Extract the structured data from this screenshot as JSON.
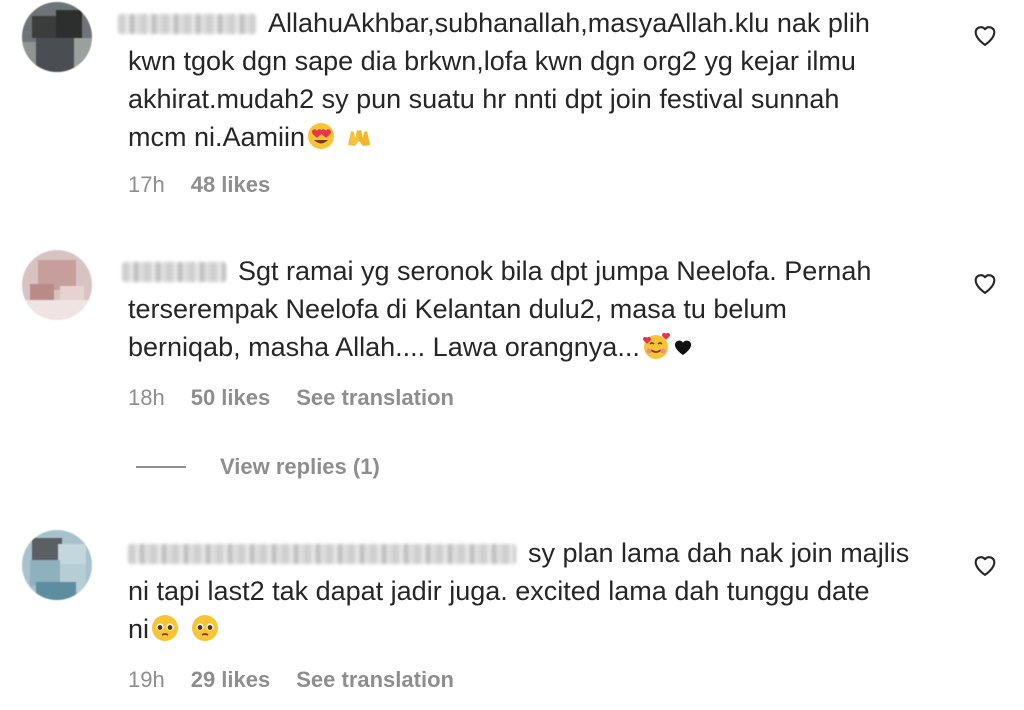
{
  "comments": [
    {
      "lines": [
        "AllahuAkhbar,subhanallah,masyaAllah.klu nak plih",
        "kwn tgok dgn sape dia brkwn,lofa kwn dgn org2 yg kejar ilmu",
        "akhirat.mudah2 sy pun suatu hr nnti dpt join festival sunnah",
        "mcm ni.Aamiin"
      ],
      "emojis": [
        "heart-eyes-emoji",
        "raised-hands-emoji"
      ],
      "time": "17h",
      "likes": "48 likes",
      "translation": ""
    },
    {
      "lines": [
        "Sgt ramai yg seronok bila dpt jumpa Neelofa. Pernah",
        "terserempak Neelofa di Kelantan dulu2, masa tu belum",
        "berniqab, masha Allah.... Lawa orangnya..."
      ],
      "emojis": [
        "smiling-hearts-emoji",
        "black-heart-emoji"
      ],
      "time": "18h",
      "likes": "50 likes",
      "translation": "See translation"
    },
    {
      "lines": [
        "sy plan lama dah nak join majlis",
        "ni tapi last2 tak dapat jadir juga. excited lama dah tunggu date",
        "ni"
      ],
      "emojis": [
        "pleading-face-emoji",
        "pleading-face-emoji"
      ],
      "time": "19h",
      "likes": "29 likes",
      "translation": "See translation"
    }
  ],
  "view_replies": "View replies (1)",
  "colors": {
    "text": "#262626",
    "meta": "#8e8e8e"
  }
}
